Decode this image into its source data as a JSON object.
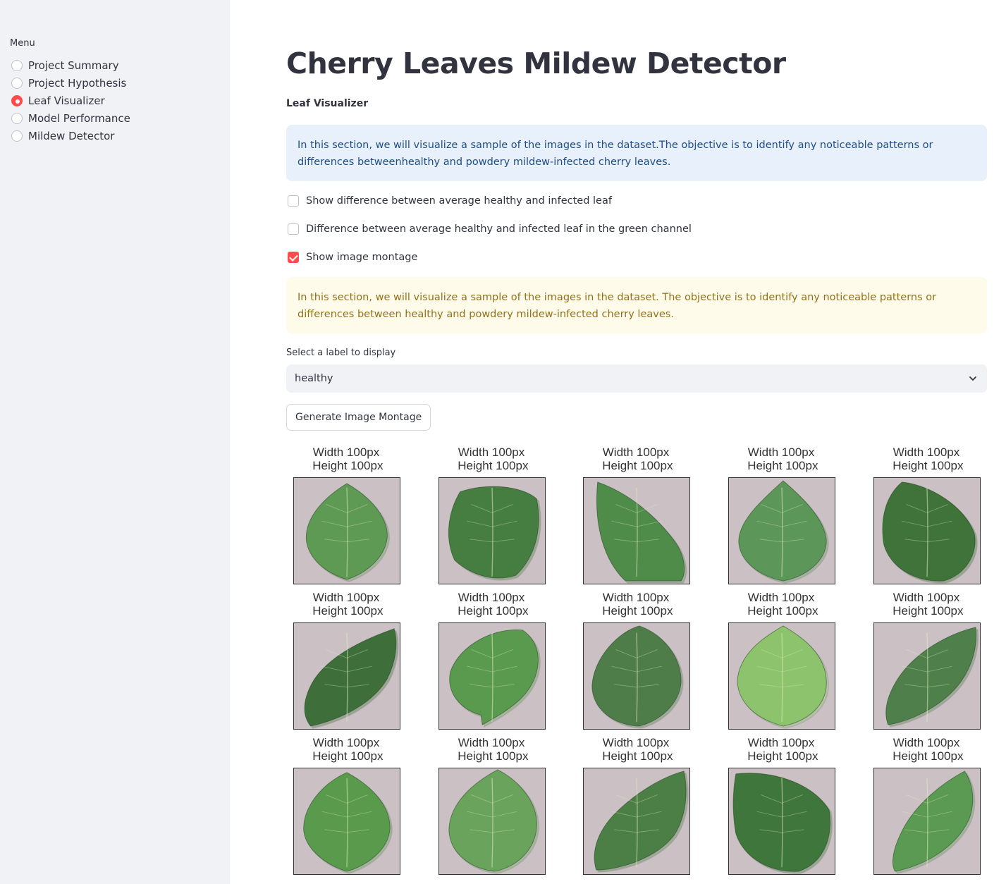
{
  "sidebar": {
    "menu_label": "Menu",
    "items": [
      {
        "label": "Project Summary",
        "selected": false
      },
      {
        "label": "Project Hypothesis",
        "selected": false
      },
      {
        "label": "Leaf Visualizer",
        "selected": true
      },
      {
        "label": "Model Performance",
        "selected": false
      },
      {
        "label": "Mildew Detector",
        "selected": false
      }
    ]
  },
  "main": {
    "title": "Cherry Leaves Mildew Detector",
    "subtitle": "Leaf Visualizer",
    "info_text": "In this section, we will visualize a sample of the images in the dataset.The objective is to identify any noticeable patterns or differences betweenhealthy and powdery mildew-infected cherry leaves.",
    "checkboxes": [
      {
        "label": "Show difference between average healthy and infected leaf",
        "checked": false
      },
      {
        "label": "Difference between average healthy and infected leaf in the green channel",
        "checked": false
      },
      {
        "label": "Show image montage",
        "checked": true
      }
    ],
    "warning_text": "In this section, we will visualize a sample of the images in the dataset. The objective is to identify any noticeable patterns or differences between healthy and powdery mildew-infected cherry leaves.",
    "select": {
      "label": "Select a label to display",
      "value": "healthy"
    },
    "button_label": "Generate Image Montage"
  },
  "montage": {
    "caption": "Width 100px\n Height 100px",
    "images": [
      {
        "alt": "healthy cherry leaf 1",
        "leaf_color": "#5f9a55"
      },
      {
        "alt": "healthy cherry leaf 2",
        "leaf_color": "#467d41"
      },
      {
        "alt": "healthy cherry leaf 3",
        "leaf_color": "#4f8c4a"
      },
      {
        "alt": "healthy cherry leaf 4",
        "leaf_color": "#5d9659"
      },
      {
        "alt": "healthy cherry leaf 5",
        "leaf_color": "#3f7339"
      },
      {
        "alt": "healthy cherry leaf 6",
        "leaf_color": "#3e6f3a"
      },
      {
        "alt": "healthy cherry leaf 7",
        "leaf_color": "#5a9a4e"
      },
      {
        "alt": "healthy cherry leaf 8",
        "leaf_color": "#4f7d4a"
      },
      {
        "alt": "healthy cherry leaf 9",
        "leaf_color": "#8cc36c"
      },
      {
        "alt": "healthy cherry leaf 10",
        "leaf_color": "#4f7f4a"
      },
      {
        "alt": "healthy cherry leaf 11",
        "leaf_color": "#5a9a4c"
      },
      {
        "alt": "healthy cherry leaf 12",
        "leaf_color": "#6aa35c"
      },
      {
        "alt": "healthy cherry leaf 13",
        "leaf_color": "#4c7f45"
      },
      {
        "alt": "healthy cherry leaf 14",
        "leaf_color": "#3f763c"
      },
      {
        "alt": "healthy cherry leaf 15",
        "leaf_color": "#5a9a52"
      }
    ]
  },
  "colors": {
    "accent": "#ff4b4b",
    "sidebar_bg": "#f0f2f6",
    "info_bg": "#e8f0fb",
    "warning_bg": "#fffbea"
  }
}
